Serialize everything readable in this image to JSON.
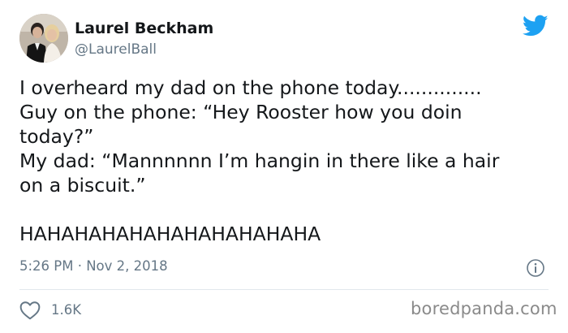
{
  "author": {
    "display_name": "Laurel Beckham",
    "handle": "@LaurelBall"
  },
  "tweet": {
    "lines": [
      "I overheard my dad on the phone today..............",
      "Guy on the phone: “Hey Rooster how you doin",
      "today?”",
      "My dad: “Mannnnnn I’m hangin in there like a hair",
      "on a biscuit.”",
      "",
      "HAHAHAHAHAHAHAHAHAHAHA"
    ],
    "timestamp": "5:26 PM · Nov 2, 2018",
    "likes": "1.6K"
  },
  "watermark": "boredpanda.com",
  "icons": {
    "brand": "twitter-bird-icon",
    "info": "info-icon",
    "like": "heart-icon"
  },
  "colors": {
    "twitter_blue": "#1da1f2",
    "text": "#14171a",
    "secondary_text": "#657786",
    "divider": "#e1e8ed"
  }
}
